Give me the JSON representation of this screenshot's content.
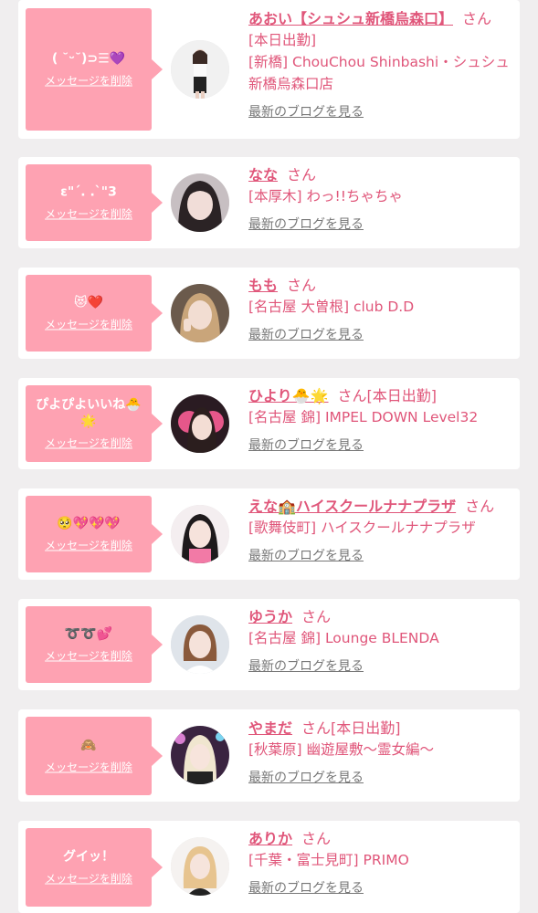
{
  "delete_label": "メッセージを削除",
  "blog_label": "最新のブログを見る",
  "san_label": "さん",
  "colors": {
    "page_bg": "#f0eeef",
    "card_bg": "#ffffff",
    "bubble_bg": "#fea2b2",
    "accent": "#e0567a",
    "muted": "#777777"
  },
  "cards": [
    {
      "message": "( ˘ᵕ˘)⊃☰💜",
      "cast_name": "あおい【シュシュ新橋烏森口】",
      "status": "",
      "shop_lines": [
        "[本日出勤]",
        "[新橋] ChouChou Shinbashi・シュシュ新橋烏森口店"
      ],
      "avatar_icon": "woman-standing-portrait"
    },
    {
      "message": "ε\"´. .`\"3",
      "cast_name": "なな",
      "status": "",
      "shop_lines": [
        "[本厚木] わっ!!ちゃちゃ"
      ],
      "avatar_icon": "woman-selfie-portrait"
    },
    {
      "message": "😻❤️",
      "cast_name": "もも",
      "status": "",
      "shop_lines": [
        "[名古屋 大曽根] club D.D"
      ],
      "avatar_icon": "woman-peace-sign-portrait"
    },
    {
      "message": "ぴよぴよいいね🐣🌟",
      "cast_name": "ひより🐣🌟",
      "status": "[本日出勤]",
      "shop_lines": [
        "[名古屋 錦] IMPEL DOWN Level32"
      ],
      "avatar_icon": "woman-logo-background-portrait"
    },
    {
      "message": "🥺💖💖💖",
      "cast_name": "えな🏫ハイスクールナナプラザ",
      "status": "",
      "shop_lines": [
        "[歌舞伎町] ハイスクールナナプラザ"
      ],
      "avatar_icon": "woman-uniform-portrait"
    },
    {
      "message": "➰➰💕",
      "cast_name": "ゆうか",
      "status": "",
      "shop_lines": [
        "[名古屋 錦] Lounge BLENDA"
      ],
      "avatar_icon": "woman-white-dress-portrait"
    },
    {
      "message": "🙈",
      "cast_name": "やまだ",
      "status": "[本日出勤]",
      "shop_lines": [
        "[秋葉原] 幽遊屋敷〜霊女編〜"
      ],
      "avatar_icon": "woman-costume-portrait"
    },
    {
      "message": "グイッ！",
      "cast_name": "ありか",
      "status": "",
      "shop_lines": [
        "[千葉・富士見町] PRIMO"
      ],
      "avatar_icon": "woman-blonde-portrait"
    }
  ]
}
